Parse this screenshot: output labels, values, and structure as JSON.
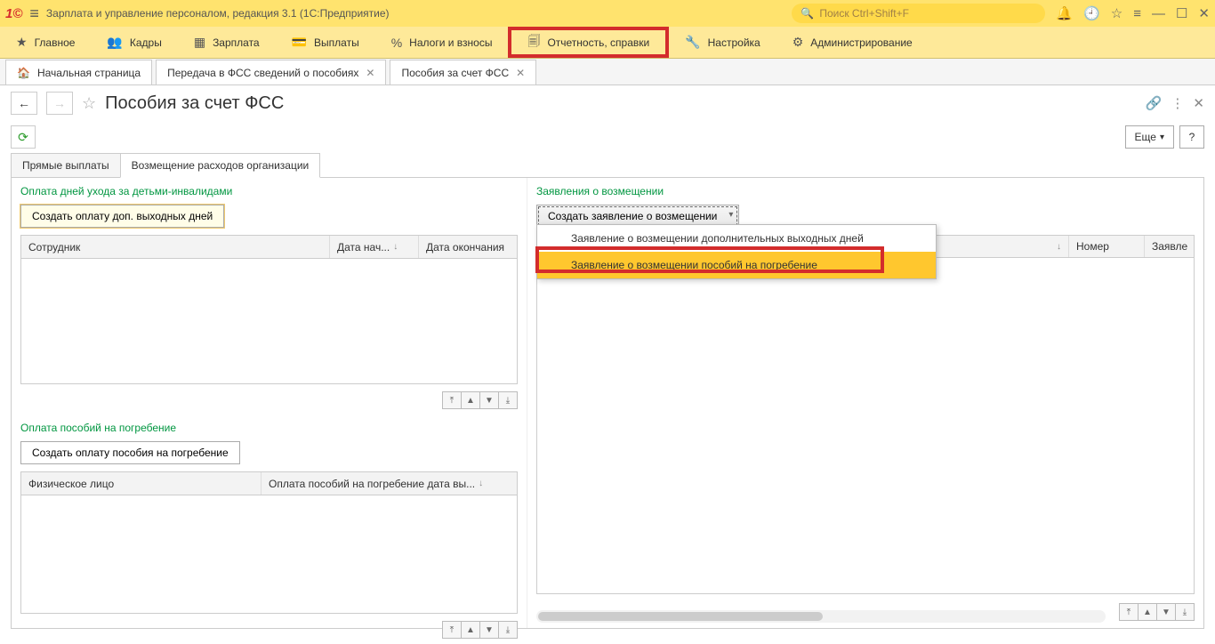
{
  "titlebar": {
    "app_title": "Зарплата и управление персоналом, редакция 3.1  (1С:Предприятие)",
    "search_placeholder": "Поиск Ctrl+Shift+F"
  },
  "main_menu": [
    {
      "icon": "★",
      "label": "Главное"
    },
    {
      "icon": "👥",
      "label": "Кадры"
    },
    {
      "icon": "▦",
      "label": "Зарплата"
    },
    {
      "icon": "💳",
      "label": "Выплаты"
    },
    {
      "icon": "%",
      "label": "Налоги и взносы"
    },
    {
      "icon": "🗐",
      "label": "Отчетность, справки",
      "highlighted": true
    },
    {
      "icon": "🔧",
      "label": "Настройка"
    },
    {
      "icon": "⚙",
      "label": "Администрирование"
    }
  ],
  "tabs": [
    {
      "icon": "🏠",
      "label": "Начальная страница",
      "closable": false
    },
    {
      "label": "Передача в ФСС сведений о пособиях",
      "closable": true
    },
    {
      "label": "Пособия за счет ФСС",
      "closable": true
    }
  ],
  "page": {
    "title": "Пособия за счет ФСС",
    "more_label": "Еще",
    "help_label": "?"
  },
  "inner_tabs": [
    {
      "label": "Прямые выплаты"
    },
    {
      "label": "Возмещение расходов организации",
      "active": true
    }
  ],
  "left": {
    "section1_title": "Оплата дней ухода за детьми-инвалидами",
    "btn1": "Создать оплату доп. выходных дней",
    "grid1_cols": [
      "Сотрудник",
      "Дата нач...",
      "Дата окончания"
    ],
    "section2_title": "Оплата пособий на погребение",
    "btn2": "Создать оплату пособия на погребение",
    "grid2_cols": [
      "Физическое лицо",
      "Оплата пособий на погребение дата вы..."
    ]
  },
  "right": {
    "section_title": "Заявления о возмещении",
    "dropdown_label": "Создать заявление о возмещении",
    "popup_items": [
      "Заявление о возмещении дополнительных выходных дней",
      "Заявление о возмещении пособий на погребение"
    ],
    "grid_cols": [
      "",
      "Номер",
      "Заявле"
    ]
  }
}
